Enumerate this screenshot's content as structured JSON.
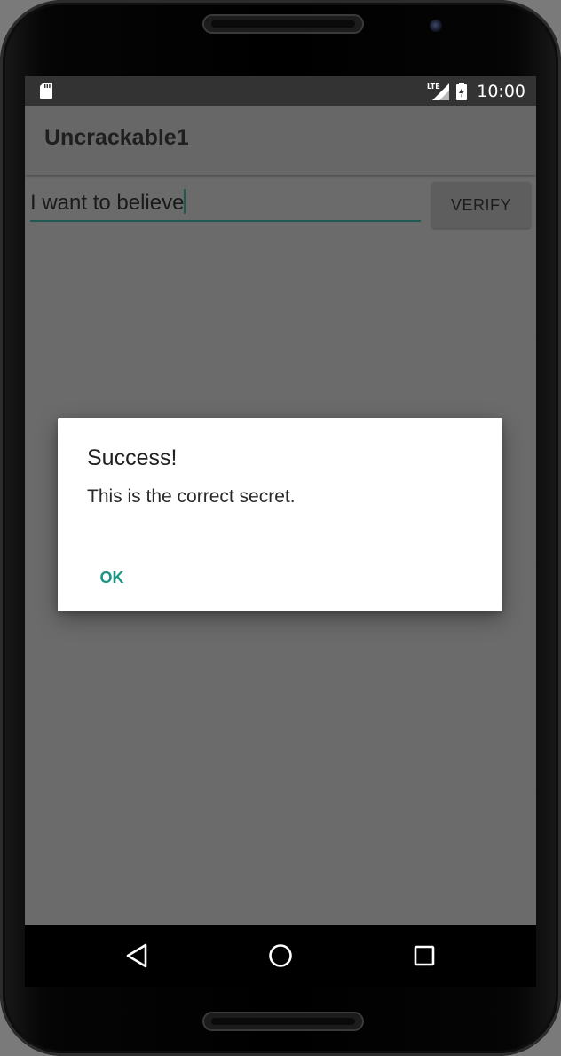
{
  "statusbar": {
    "time": "10:00",
    "network": "LTE",
    "icons": [
      "sd-card-icon",
      "lte-signal-icon",
      "battery-charging-icon"
    ]
  },
  "app": {
    "title": "Uncrackable1"
  },
  "form": {
    "input_value": "I want to believe",
    "verify_label": "VERIFY"
  },
  "dialog": {
    "title": "Success!",
    "message": "This is the correct secret.",
    "ok_label": "OK"
  },
  "navbar": {
    "buttons": [
      "back-icon",
      "home-icon",
      "recents-icon"
    ]
  },
  "colors": {
    "accent": "#1a9484",
    "dim_background": "#6b6b6b",
    "statusbar": "#333333"
  }
}
